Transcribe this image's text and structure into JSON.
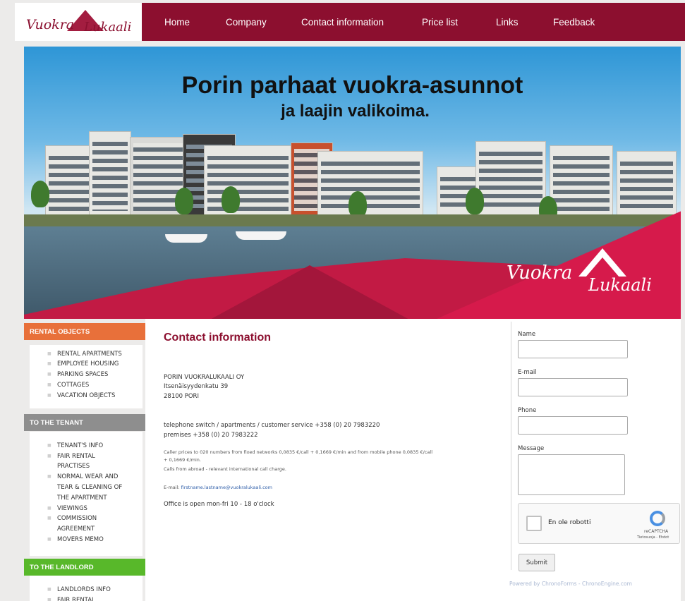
{
  "header": {
    "logo_text_1": "Vuokra",
    "logo_text_2": "Lukaali",
    "nav": [
      "Home",
      "Company",
      "Contact information",
      "Price list",
      "Links",
      "Feedback"
    ]
  },
  "hero": {
    "headline": "Porin parhaat vuokra-asunnot",
    "subheadline": "ja laajin valikoima.",
    "logo_text_1": "Vuokra",
    "logo_text_2": "Lukaali"
  },
  "sidebar": {
    "sections": [
      {
        "title": "RENTAL OBJECTS",
        "color": "#e8703a",
        "items": [
          "RENTAL APARTMENTS",
          "EMPLOYEE HOUSING",
          "PARKING SPACES",
          "COTTAGES",
          "VACATION OBJECTS"
        ]
      },
      {
        "title": "TO THE TENANT",
        "color": "#8e8e8e",
        "items": [
          "TENANT'S INFO",
          "FAIR RENTAL",
          "PRACTISES",
          "NORMAL WEAR AND",
          "TEAR & CLEANING OF",
          "THE APARTMENT",
          "VIEWINGS",
          "COMMISSION",
          "AGREEMENT",
          "MOVERS MEMO"
        ]
      },
      {
        "title": "TO THE LANDLORD",
        "color": "#58b82a",
        "items": [
          "LANDLORDS INFO",
          "FAIR RENTAL"
        ]
      }
    ]
  },
  "main": {
    "title": "Contact information",
    "company": "PORIN VUOKRALUKAALI OY",
    "street": "Itsenäisyydenkatu 39",
    "city": "28100 PORI",
    "phone_line1": "telephone switch / apartments / customer service +358 (0) 20 7983220",
    "phone_line2": "premises +358 (0) 20 7983222",
    "caller_line1": "Caller prices to 020 numbers from fixed networks 0,0835 €/call + 0,1669 €/min and from mobile phone 0,0835 €/call",
    "caller_line2": "+ 0,1669 €/min.",
    "caller_line3": "Calls from abroad - relevant international call charge.",
    "email_label": "E-mail: ",
    "email_link": "firstname.lastname@vuokralukaali.com",
    "hours": "Office is open mon-fri 10 - 18 o'clock"
  },
  "form": {
    "name_label": "Name",
    "email_label": "E-mail",
    "phone_label": "Phone",
    "message_label": "Message",
    "captcha_text": "En ole robotti",
    "captcha_brand": "reCAPTCHA",
    "captcha_terms": "Tietosuoja - Ehdot",
    "submit": "Submit",
    "powered": "Powered by ChronoForms - ChronoEngine.com"
  }
}
